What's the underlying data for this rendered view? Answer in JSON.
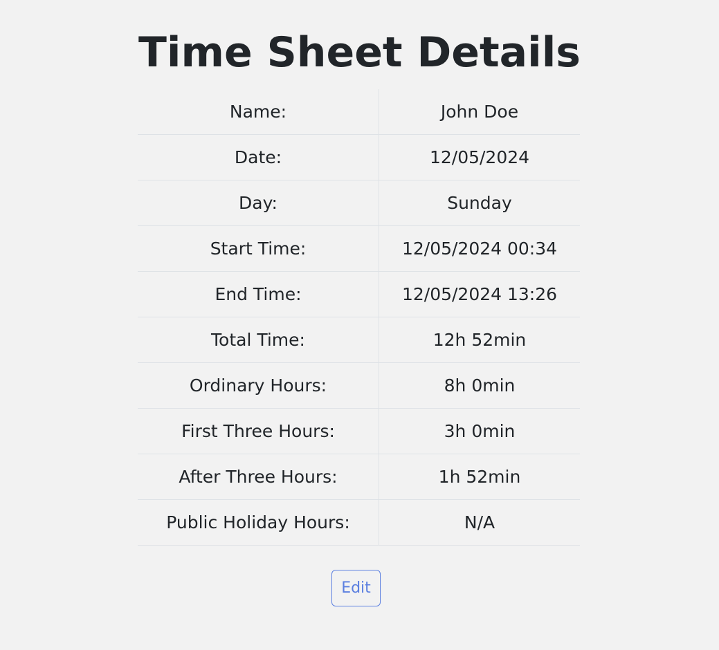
{
  "page": {
    "title": "Time Sheet Details"
  },
  "details": {
    "rows": [
      {
        "label": "Name:",
        "value": "John Doe"
      },
      {
        "label": "Date:",
        "value": "12/05/2024"
      },
      {
        "label": "Day:",
        "value": "Sunday"
      },
      {
        "label": "Start Time:",
        "value": "12/05/2024 00:34"
      },
      {
        "label": "End Time:",
        "value": "12/05/2024 13:26"
      },
      {
        "label": "Total Time:",
        "value": "12h 52min"
      },
      {
        "label": "Ordinary Hours:",
        "value": "8h 0min"
      },
      {
        "label": "First Three Hours:",
        "value": "3h 0min"
      },
      {
        "label": "After Three Hours:",
        "value": "1h 52min"
      },
      {
        "label": "Public Holiday Hours:",
        "value": "N/A"
      }
    ]
  },
  "actions": {
    "edit_label": "Edit"
  },
  "colors": {
    "background": "#f2f2f2",
    "text": "#212529",
    "border": "#dee2e6",
    "accent": "#5b7fe0"
  }
}
